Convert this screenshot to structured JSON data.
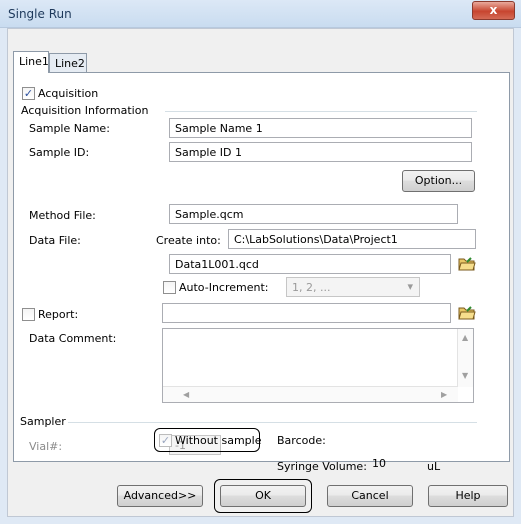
{
  "window": {
    "title": "Single Run",
    "close_glyph": "x"
  },
  "tabs": [
    {
      "label": "Line1"
    },
    {
      "label": "Line2"
    }
  ],
  "acquisition": {
    "checkbox_label": "Acquisition",
    "checked": true,
    "group_label": "Acquisition Information",
    "sample_name_label": "Sample Name:",
    "sample_name_value": "Sample Name 1",
    "sample_id_label": "Sample ID:",
    "sample_id_value": "Sample ID 1",
    "option_button": "Option...",
    "method_file_label": "Method File:",
    "method_file_value": "Sample.qcm",
    "data_file_label": "Data File:",
    "create_into_label": "Create into:",
    "create_into_value": "C:\\LabSolutions\\Data\\Project1",
    "data_file_value": "Data1L001.qcd",
    "auto_increment_label": "Auto-Increment:",
    "auto_increment_checked": false,
    "auto_increment_value": "1, 2, ...",
    "report_label": "Report:",
    "report_checked": false,
    "report_value": "",
    "data_comment_label": "Data Comment:",
    "data_comment_value": ""
  },
  "sampler": {
    "group_label": "Sampler",
    "vial_label": "Vial#:",
    "vial_value": "-1",
    "without_sample_label": "Without sample",
    "without_sample_checked": true,
    "barcode_label": "Barcode:",
    "syringe_volume_label": "Syringe Volume:",
    "syringe_volume_value": "10",
    "syringe_volume_unit": "uL"
  },
  "buttons": {
    "advanced": "Advanced>>",
    "ok": "OK",
    "cancel": "Cancel",
    "help": "Help"
  },
  "icons": {
    "checkmark": "✓",
    "dropdown": "▾",
    "scroll_up": "▲",
    "scroll_down": "▼",
    "scroll_left": "◀",
    "scroll_right": "▶"
  }
}
